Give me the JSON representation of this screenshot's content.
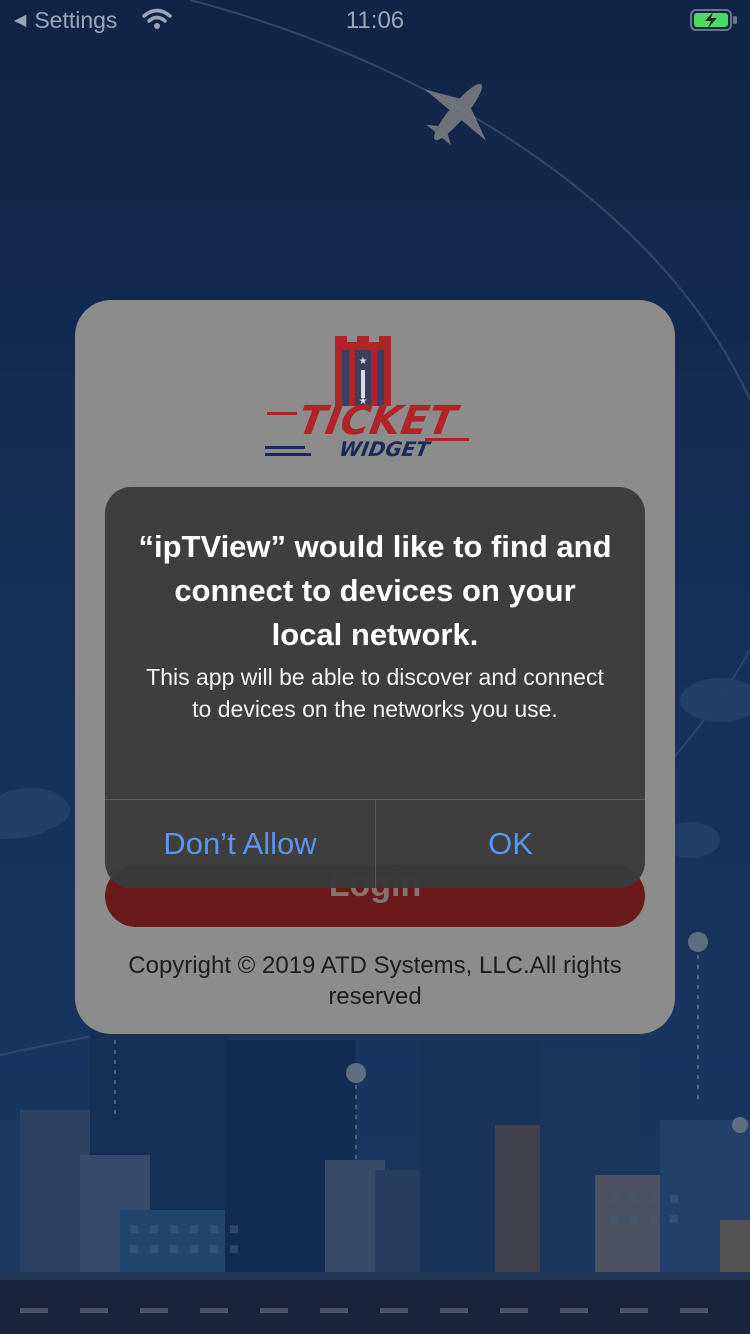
{
  "status_bar": {
    "back_label": "Settings",
    "time": "11:06",
    "back_icon": "back-chevron-icon",
    "wifi_icon": "wifi-icon",
    "battery_icon": "battery-charging-icon",
    "battery_color": "#4cd964"
  },
  "login_card": {
    "logo_line1": "TICKET",
    "logo_line2": "WIDGET",
    "login_button_label": "Login",
    "copyright": "Copyright © 2019 ATD Systems, LLC.All rights reserved"
  },
  "alert": {
    "title": "“ipTView” would like to find and connect to devices on your local network.",
    "message": "This app will be able to discover and connect to devices on the networks you use.",
    "dont_allow_label": "Don’t Allow",
    "ok_label": "OK",
    "button_color": "#5797ef"
  },
  "colors": {
    "background": "#22498a",
    "logo_red": "#c8262a",
    "logo_navy": "#1a2a5a"
  }
}
